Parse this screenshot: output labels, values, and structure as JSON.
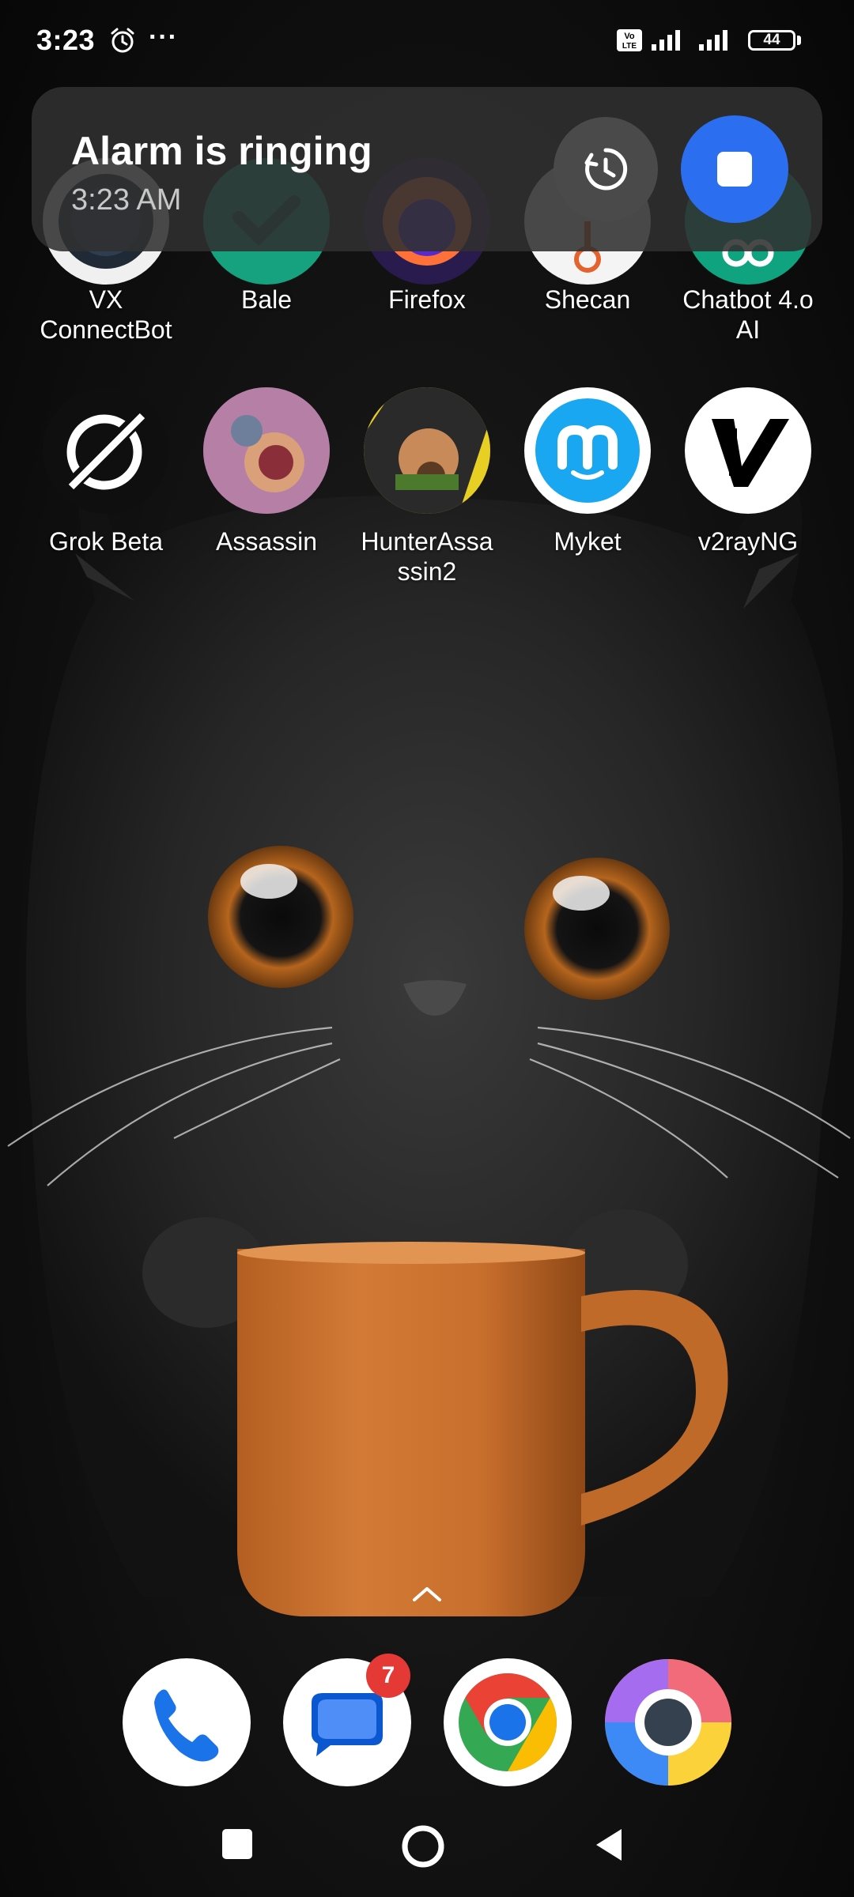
{
  "status_bar": {
    "time": "3:23",
    "alarm_icon": "alarm-clock-icon",
    "more_icon": "more-dots-icon",
    "volte": "Vo LTE",
    "battery": "44"
  },
  "notification": {
    "title": "Alarm is ringing",
    "time": "3:23 AM",
    "snooze_icon": "snooze-timer-icon",
    "stop_icon": "stop-icon",
    "accent": "#2b6ff0"
  },
  "apps_row1": [
    {
      "label": "VX\nConnectBot"
    },
    {
      "label": "Bale"
    },
    {
      "label": "Firefox"
    },
    {
      "label": "Shecan"
    },
    {
      "label": "Chatbot 4.o\nAI"
    }
  ],
  "apps_row2": [
    {
      "label": "Grok Beta"
    },
    {
      "label": "Assassin"
    },
    {
      "label": "HunterAssa\nssin2"
    },
    {
      "label": "Myket"
    },
    {
      "label": "v2rayNG"
    }
  ],
  "dock": {
    "phone": "phone-icon",
    "messages": "messages-icon",
    "messages_badge": "7",
    "chrome": "chrome-icon",
    "camera": "camera-icon"
  },
  "swipe_up_icon": "chevron-up-icon",
  "nav": {
    "recent": "recent-apps-icon",
    "home": "home-icon",
    "back": "back-icon"
  }
}
